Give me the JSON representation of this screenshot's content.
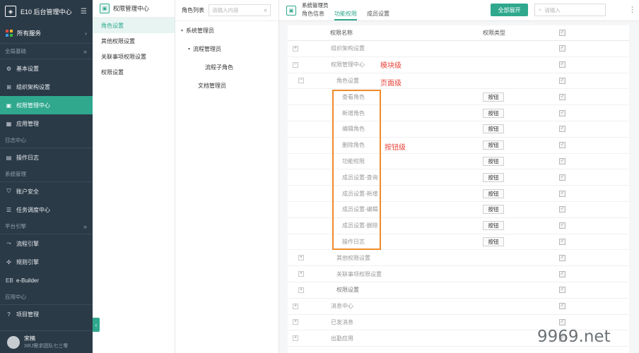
{
  "app": {
    "title": "E10 后台管理中心",
    "all_services": "所有服务"
  },
  "sidebar": {
    "groups": [
      {
        "label": "全局基础",
        "items": [
          {
            "label": "基本设置",
            "icon": "gear-icon"
          },
          {
            "label": "组织架构设置",
            "icon": "org-icon"
          },
          {
            "label": "权限管理中心",
            "icon": "id-card-icon",
            "active": true
          },
          {
            "label": "应用管理",
            "icon": "apps-icon"
          }
        ]
      },
      {
        "label": "日志中心",
        "items": [
          {
            "label": "操作日志",
            "icon": "doc-icon"
          }
        ]
      },
      {
        "label": "系统管理",
        "items": [
          {
            "label": "账户安全",
            "icon": "shield-icon"
          },
          {
            "label": "任务调度中心",
            "icon": "list-icon"
          }
        ]
      },
      {
        "label": "平台引擎",
        "items": [
          {
            "label": "流程引擎",
            "icon": "flow-icon"
          },
          {
            "label": "规则引擎",
            "icon": "rule-icon"
          },
          {
            "label": "e-Builder",
            "icon": "eb-icon"
          }
        ]
      },
      {
        "label": "应用中心",
        "items": [
          {
            "label": "项目管理",
            "icon": "help-circle-icon"
          }
        ]
      }
    ],
    "user": {
      "name": "宋楠",
      "team": "XRJ需求团队七三零"
    }
  },
  "submenu": {
    "title": "权限管理中心",
    "items": [
      {
        "label": "角色设置",
        "active": true
      },
      {
        "label": "其他权限设置"
      },
      {
        "label": "关联事项权限设置"
      },
      {
        "label": "权限设置"
      }
    ]
  },
  "tree": {
    "label": "角色列表",
    "search_placeholder": "请输入内容",
    "nodes": [
      {
        "label": "系统管理员",
        "level": 0,
        "toggle": "▾"
      },
      {
        "label": "流程管理员",
        "level": 1,
        "toggle": "▾"
      },
      {
        "label": "流程子角色",
        "level": 2,
        "toggle": ""
      },
      {
        "label": "文档管理员",
        "level": 1,
        "toggle": ""
      }
    ]
  },
  "main": {
    "title": "系统管理员",
    "tabs": [
      {
        "label": "角色信息"
      },
      {
        "label": "功能权限",
        "active": true
      },
      {
        "label": "成员设置"
      }
    ],
    "expand_all": "全部展开",
    "search_placeholder": "请输入"
  },
  "table": {
    "headers": {
      "name": "权限名称",
      "type": "权限类型"
    },
    "rows": [
      {
        "name": "组织架构设置",
        "indent": 0,
        "toggle": "+",
        "muted": true
      },
      {
        "name": "权限管理中心",
        "indent": 0,
        "toggle": "−",
        "muted": true
      },
      {
        "name": "角色设置",
        "indent": 1,
        "toggle": "−",
        "muted": true
      },
      {
        "name": "查看角色",
        "indent": 2,
        "type": "按钮"
      },
      {
        "name": "新增角色",
        "indent": 2,
        "type": "按钮"
      },
      {
        "name": "编辑角色",
        "indent": 2,
        "type": "按钮"
      },
      {
        "name": "删除角色",
        "indent": 2,
        "type": "按钮"
      },
      {
        "name": "功能权限",
        "indent": 2,
        "type": "按钮"
      },
      {
        "name": "成员设置-查询",
        "indent": 2,
        "type": "按钮"
      },
      {
        "name": "成员设置-新增",
        "indent": 2,
        "type": "按钮"
      },
      {
        "name": "成员设置-编辑",
        "indent": 2,
        "type": "按钮"
      },
      {
        "name": "成员设置-删除",
        "indent": 2,
        "type": "按钮"
      },
      {
        "name": "操作日志",
        "indent": 2,
        "type": "按钮"
      },
      {
        "name": "其他权限设置",
        "indent": 1,
        "toggle": "+",
        "muted": true
      },
      {
        "name": "关联事项权限设置",
        "indent": 1,
        "toggle": "+",
        "muted": true
      },
      {
        "name": "权限设置",
        "indent": 1,
        "toggle": "+",
        "muted": false
      },
      {
        "name": "消息中心",
        "indent": 0,
        "toggle": "+",
        "muted": true
      },
      {
        "name": "已发消息",
        "indent": 0,
        "toggle": "+",
        "muted": true
      },
      {
        "name": "出勤应用",
        "indent": 0,
        "toggle": "+",
        "muted": true
      }
    ]
  },
  "annotations": {
    "module_level": "模块级",
    "page_level": "页面级",
    "button_level": "按钮级"
  },
  "watermark": "9969.net",
  "colors": {
    "accent": "#2fa88e",
    "sidebar_bg": "#2b3a47",
    "annotation": "#e8463a",
    "highlight_box": "#f08a2a"
  }
}
